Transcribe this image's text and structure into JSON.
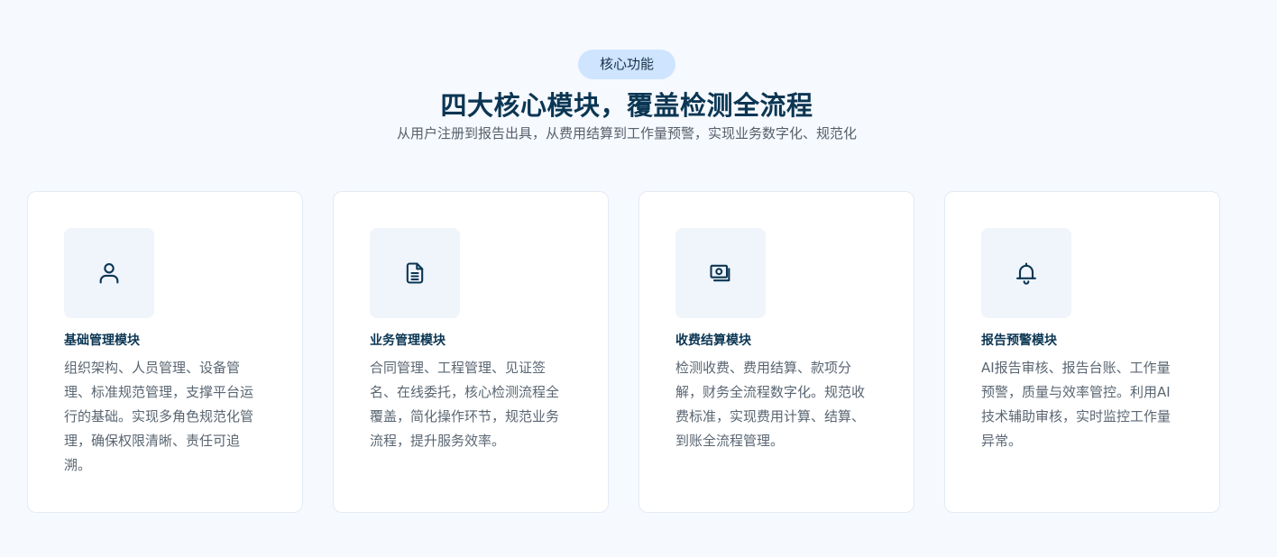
{
  "header": {
    "badge": "核心功能",
    "title": "四大核心模块，覆盖检测全流程",
    "subtitle": "从用户注册到报告出具，从费用结算到工作量预警，实现业务数字化、规范化"
  },
  "modules": [
    {
      "icon": "user-icon",
      "title": "基础管理模块",
      "description": "组织架构、人员管理、设备管理、标准规范管理，支撑平台运行的基础。实现多角色规范化管理，确保权限清晰、责任可追溯。"
    },
    {
      "icon": "document-icon",
      "title": "业务管理模块",
      "description": "合同管理、工程管理、见证签名、在线委托，核心检测流程全覆盖，简化操作环节，规范业务流程，提升服务效率。"
    },
    {
      "icon": "money-icon",
      "title": "收费结算模块",
      "description": "检测收费、费用结算、款项分解，财务全流程数字化。规范收费标准，实现费用计算、结算、到账全流程管理。"
    },
    {
      "icon": "bell-icon",
      "title": "报告预警模块",
      "description": "AI报告审核、报告台账、工作量预警，质量与效率管控。利用AI技术辅助审核，实时监控工作量异常。"
    }
  ],
  "colors": {
    "background": "#f6f9fe",
    "badge_bg": "#cfe5ff",
    "title": "#0b3653",
    "icon_bg": "#f0f4fb"
  }
}
